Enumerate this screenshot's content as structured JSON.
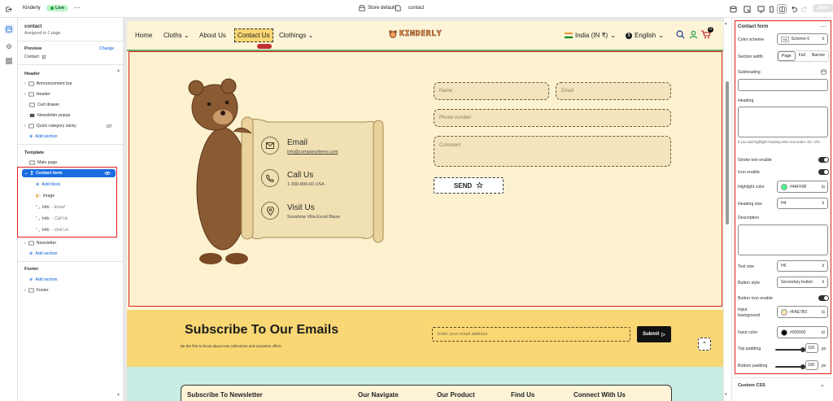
{
  "topbar": {
    "store": "Kinderly",
    "live": "Live",
    "more": "···",
    "center_store": "Store default",
    "center_page": "contact",
    "save": "Save"
  },
  "sidebar": {
    "page_title": "contact",
    "page_sub": "Assigned to 1 page",
    "preview_label": "Preview",
    "preview_change": "Change",
    "preview_value": "Contact",
    "header_title": "Header",
    "header_items": [
      "Announcement bar",
      "Header",
      "Cart drawer",
      "Newsletter popup",
      "Quick category sticky"
    ],
    "add_section": "Add section",
    "template_title": "Template",
    "template_items": [
      "Main page"
    ],
    "contact_form": "Contact form",
    "contact_children": [
      "Add block",
      "Image",
      "Info",
      "Info",
      "Info"
    ],
    "contact_children_sub": [
      "",
      "",
      "Email",
      "Call Us",
      "Visit Us"
    ],
    "after_items": [
      "Newsletter"
    ],
    "footer_title": "Footer",
    "footer_items": [
      "Footer"
    ]
  },
  "site": {
    "nav": [
      "Home",
      "Cloths",
      "About Us",
      "Contact Us",
      "Clothings"
    ],
    "logo": "KINDERLY",
    "country": "India (IN ₹)",
    "language": "English",
    "cart_count": "0",
    "info": [
      {
        "title": "Email",
        "sub": "info@companydemo.com",
        "icon": "mail-icon"
      },
      {
        "title": "Call Us",
        "sub": "1-300-800-60 USA",
        "icon": "phone-icon"
      },
      {
        "title": "Visit Us",
        "sub": "Sunshine Villa Excel Blaze",
        "icon": "location-icon"
      }
    ],
    "form": {
      "name": "Name",
      "email": "Email",
      "phone": "Phone number",
      "comment": "Comment",
      "send": "SEND"
    },
    "subscribe": {
      "title": "Subscribe To Our Emails",
      "sub": "Be the first to know about new collections and exclusive offers.",
      "placeholder": "Enter your email address",
      "button": "Submit"
    },
    "footer_cols": [
      "Subscribe To Newsletter",
      "Our Navigate",
      "Our Product",
      "Find Us",
      "Connect With Us"
    ]
  },
  "panel": {
    "title": "Contact form",
    "more": "···",
    "color_scheme_label": "Color scheme",
    "color_scheme_value": "Scheme 6",
    "color_scheme_swatch": "Aa",
    "section_width_label": "Section width",
    "section_width_options": [
      "Page",
      "Full",
      "Narrow"
    ],
    "subheading_label": "Subheading",
    "heading_label": "Heading",
    "heading_help": "If you add highlight heading write text under <b> </b>",
    "stroke_label": "Stroke text enable",
    "icon_label": "Icon enable",
    "highlight_label": "Highlight color",
    "highlight_value": "#4AFF8F",
    "heading_size_label": "Heading size",
    "heading_size_value": "H4",
    "description_label": "Description",
    "text_size_label": "Text size",
    "text_size_value": "H6",
    "button_style_label": "Button style",
    "button_style_value": "Secondary button",
    "button_icon_label": "Button icon enable",
    "input_bg_label_1": "Input",
    "input_bg_label_2": "background",
    "input_bg_value": "#FAE7B3",
    "input_color_label": "Input color",
    "input_color_value": "#000000",
    "top_padding_label": "Top padding",
    "top_padding_value": "100",
    "bottom_padding_label": "Bottom padding",
    "bottom_padding_value": "100",
    "px": "px",
    "custom_css": "Custom CSS"
  },
  "colors": {
    "highlight": "#4AFF8F",
    "input_bg": "#FAE7B3",
    "input_color": "#000000",
    "accent": "#1a6de0",
    "annotation": "#e01e1e"
  }
}
